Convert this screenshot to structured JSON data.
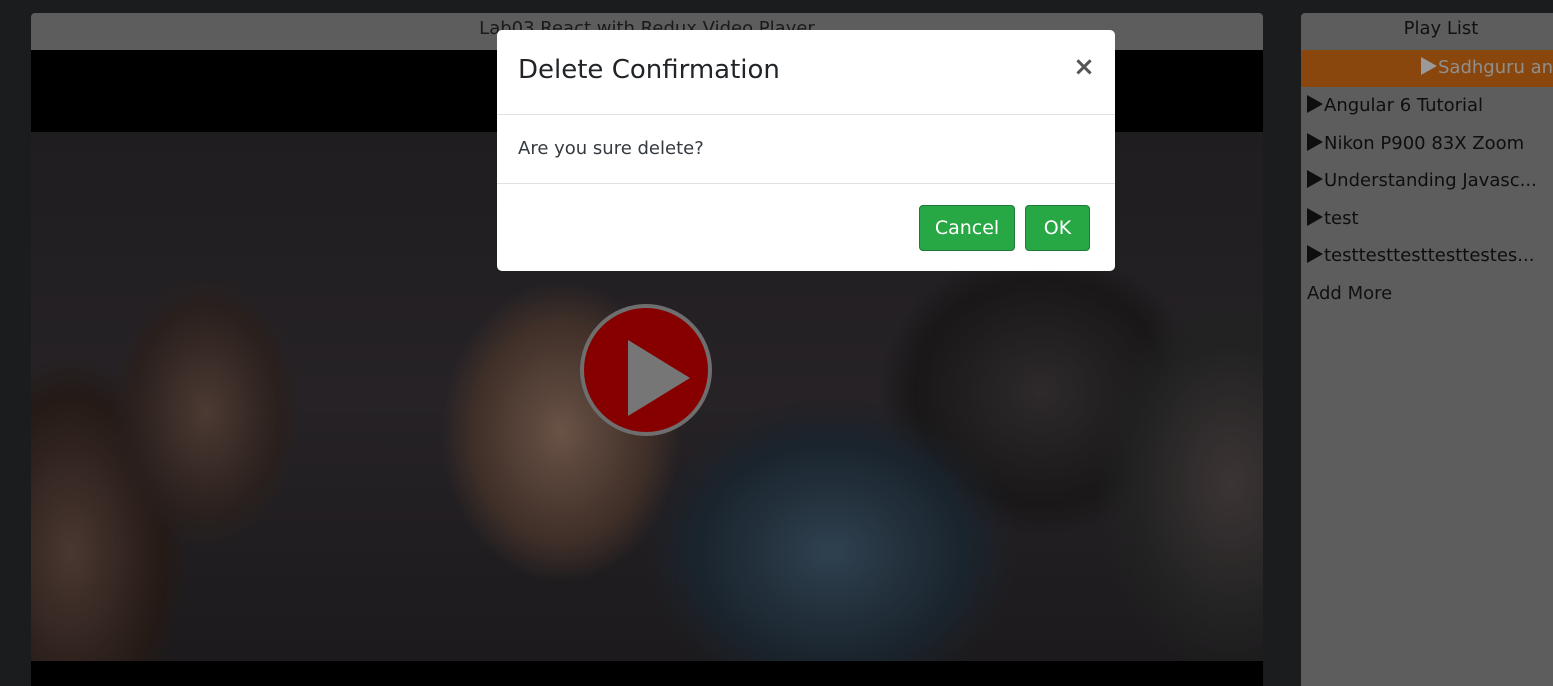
{
  "player": {
    "title": "Lab03 React with Redux Video Player"
  },
  "playlist": {
    "title": "Play List",
    "active_item": "Sadhguru and",
    "items": [
      {
        "label": "Angular 6 Tutorial"
      },
      {
        "label": "Nikon P900 83X Zoom"
      },
      {
        "label": "Understanding Javasc..."
      },
      {
        "label": "test"
      },
      {
        "label": "testtesttesttesttestes..."
      }
    ],
    "add_more": "Add More"
  },
  "modal": {
    "title": "Delete Confirmation",
    "close_glyph": "×",
    "body": "Are you sure delete?",
    "cancel_label": "Cancel",
    "ok_label": "OK"
  },
  "colors": {
    "accent_button": "#28a745",
    "active_playlist_item": "#ed7a1b",
    "play_button": "#870000"
  },
  "icons": {
    "play_button": "play-icon",
    "playlist_item": "play-triangle-icon",
    "close": "close-icon"
  }
}
